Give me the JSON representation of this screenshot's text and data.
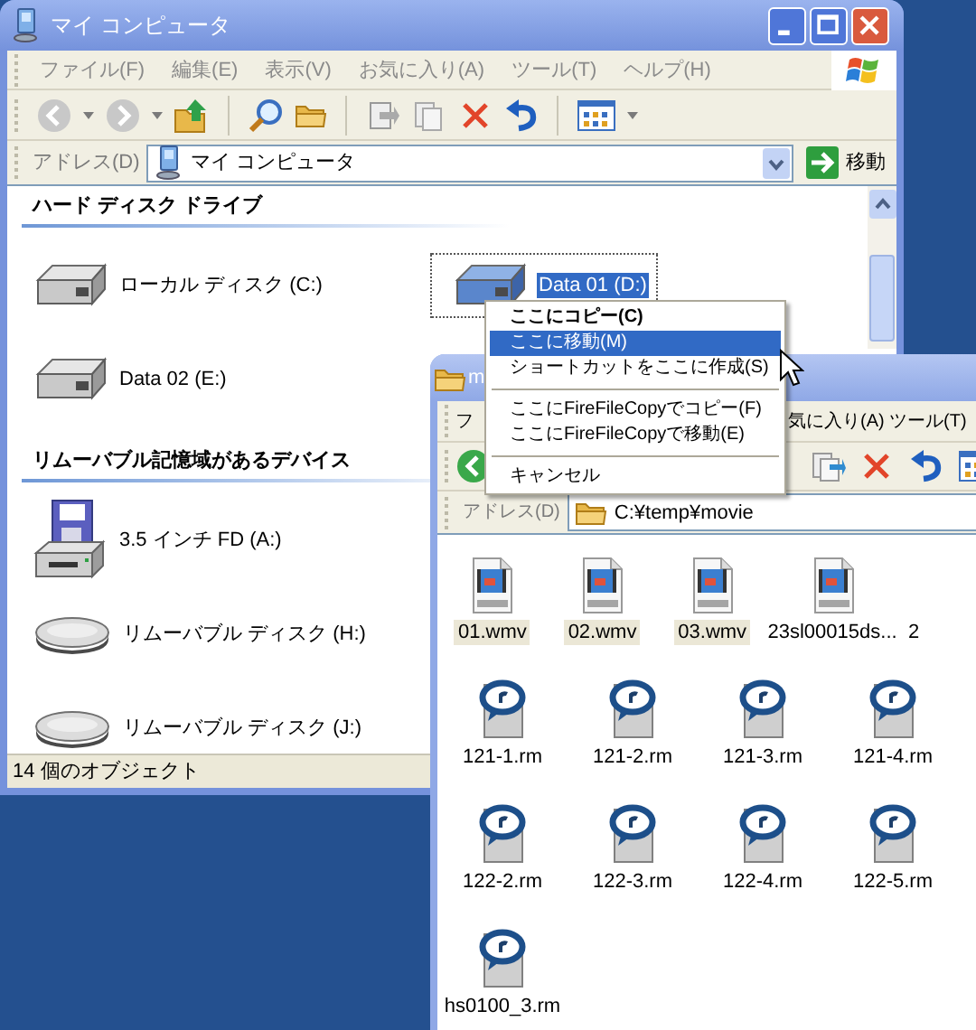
{
  "back_window": {
    "title": "マイ コンピュータ",
    "menu": [
      "ファイル(F)",
      "編集(E)",
      "表示(V)",
      "お気に入り(A)",
      "ツール(T)",
      "ヘルプ(H)"
    ],
    "address": {
      "label": "アドレス(D)",
      "value": "マイ コンピュータ",
      "go": "移動"
    },
    "sections": [
      {
        "title": "ハード ディスク ドライブ",
        "items": [
          {
            "label": "ローカル ディスク (C:)",
            "kind": "hdd",
            "selected": false
          },
          {
            "label": "Data 01 (D:)",
            "kind": "hdd",
            "selected": true
          },
          {
            "label": "Data 02 (E:)",
            "kind": "hdd",
            "selected": false
          }
        ]
      },
      {
        "title": "リムーバブル記憶域があるデバイス",
        "items": [
          {
            "label": "3.5 インチ FD (A:)",
            "kind": "floppy",
            "selected": false
          },
          {
            "label": "リムーバブル ディスク (H:)",
            "kind": "removable",
            "selected": false
          },
          {
            "label": "リムーバブル ディスク (J:)",
            "kind": "removable",
            "selected": false
          }
        ]
      }
    ],
    "status": "14 個のオブジェクト"
  },
  "front_window": {
    "title": "m",
    "menu": [
      "フ",
      "気に入り(A)",
      "ツール(T)"
    ],
    "address": {
      "label": "アドレス(D)",
      "value": "C:¥temp¥movie"
    },
    "file_rows": [
      [
        {
          "name": "01.wmv",
          "kind": "wmv",
          "selected": true
        },
        {
          "name": "02.wmv",
          "kind": "wmv",
          "selected": true
        },
        {
          "name": "03.wmv",
          "kind": "wmv",
          "selected": true
        },
        {
          "name": "23sl00015ds...",
          "kind": "wmv",
          "selected": false
        },
        {
          "name": "2",
          "kind": "cut",
          "selected": false
        }
      ],
      [
        {
          "name": "121-1.rm",
          "kind": "rm",
          "selected": false
        },
        {
          "name": "121-2.rm",
          "kind": "rm",
          "selected": false
        },
        {
          "name": "121-3.rm",
          "kind": "rm",
          "selected": false
        },
        {
          "name": "121-4.rm",
          "kind": "rm",
          "selected": false
        }
      ],
      [
        {
          "name": "122-2.rm",
          "kind": "rm",
          "selected": false
        },
        {
          "name": "122-3.rm",
          "kind": "rm",
          "selected": false
        },
        {
          "name": "122-4.rm",
          "kind": "rm",
          "selected": false
        },
        {
          "name": "122-5.rm",
          "kind": "rm",
          "selected": false
        }
      ],
      [
        {
          "name": "hs0100_3.rm",
          "kind": "rm",
          "selected": false
        }
      ]
    ]
  },
  "context_menu": {
    "items": [
      {
        "kind": "item",
        "label": "ここにコピー(C)",
        "bold": true,
        "selected": false
      },
      {
        "kind": "item",
        "label": "ここに移動(M)",
        "bold": false,
        "selected": true
      },
      {
        "kind": "item",
        "label": "ショートカットをここに作成(S)",
        "bold": false,
        "selected": false
      },
      {
        "kind": "separator"
      },
      {
        "kind": "item",
        "label": "ここにFireFileCopyでコピー(F)",
        "bold": false,
        "selected": false
      },
      {
        "kind": "item",
        "label": "ここにFireFileCopyで移動(E)",
        "bold": false,
        "selected": false
      },
      {
        "kind": "separator"
      },
      {
        "kind": "item",
        "label": "キャンセル",
        "bold": false,
        "selected": false
      }
    ]
  }
}
